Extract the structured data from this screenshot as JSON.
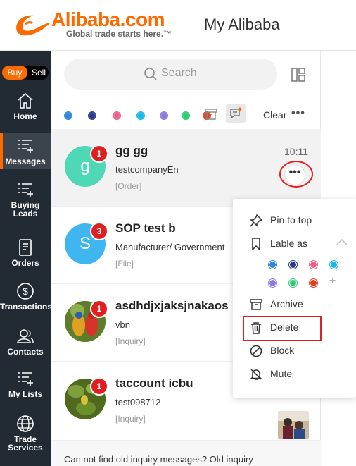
{
  "header": {
    "logo_word": "Alibaba.com",
    "logo_tagline": "Global trade starts here.™",
    "title": "My Alibaba"
  },
  "leftnav": {
    "buy_label": "Buy",
    "sell_label": "Sell",
    "items": [
      {
        "label": "Home",
        "icon": "home-icon"
      },
      {
        "label": "Messages",
        "icon": "messages-icon",
        "active": true
      },
      {
        "label": "Buying Leads",
        "icon": "buying-leads-icon"
      },
      {
        "label": "Orders",
        "icon": "orders-icon"
      },
      {
        "label": "Transactions",
        "icon": "dollar-icon"
      },
      {
        "label": "Contacts",
        "icon": "contacts-icon"
      },
      {
        "label": "My Lists",
        "icon": "lists-icon"
      },
      {
        "label": "Trade Services",
        "icon": "globe-icon"
      }
    ]
  },
  "search": {
    "placeholder": "Search"
  },
  "filterbar": {
    "colors": [
      "#2e86de",
      "#2b3a8c",
      "#f25c8a",
      "#17b8e6",
      "#8b7be0",
      "#2ecc71",
      "#e63c1e"
    ],
    "clear_label": "Clear",
    "more_label": "•••"
  },
  "conversations": [
    {
      "avatar_letter": "g",
      "avatar_color": "#4fd8b6",
      "badge": "1",
      "name": "gg gg",
      "sub": "testcompanyEn",
      "tag": "[Order]",
      "time": "10:11",
      "more": "•••"
    },
    {
      "avatar_letter": "S",
      "avatar_color": "#3fb6f0",
      "badge": "3",
      "name": "SOP test b",
      "sub": "Manufacturer/ Government",
      "tag": "[File]"
    },
    {
      "avatar_letter": "",
      "avatar_color": "#8c6a2e",
      "badge": "1",
      "name": "asdhdjxjaksjnakaos",
      "sub": "vbn",
      "tag": "[Inquiry]"
    },
    {
      "avatar_letter": "",
      "avatar_color": "#6c8a2a",
      "badge": "1",
      "name": "taccount icbu",
      "sub": "test098712",
      "tag": "[Inquiry]"
    }
  ],
  "footer": {
    "note": "Can not find old inquiry messages?  Old inquiry"
  },
  "popup": {
    "pin_label": "Pin to top",
    "label_as": "Lable as",
    "label_colors": [
      "#2e86de",
      "#2b3a8c",
      "#f25c8a",
      "#17b8e6",
      "#8b7be0",
      "#2ecc71",
      "#e63c1e"
    ],
    "plus": "+",
    "archive_label": "Archive",
    "delete_label": "Delete",
    "block_label": "Block",
    "mute_label": "Mute"
  }
}
